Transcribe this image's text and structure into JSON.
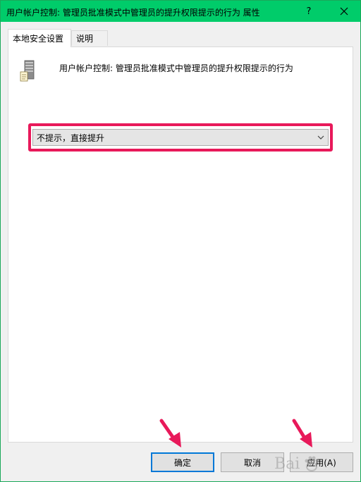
{
  "window": {
    "title": "用户帐户控制: 管理员批准模式中管理员的提升权限提示的行为 属性",
    "help_label": "?"
  },
  "tabs": [
    {
      "label": "本地安全设置",
      "active": true
    },
    {
      "label": "说明",
      "active": false
    }
  ],
  "policy": {
    "icon": "server-policy-icon",
    "title": "用户帐户控制: 管理员批准模式中管理员的提升权限提示的行为"
  },
  "setting": {
    "selected_value": "不提示，直接提升"
  },
  "buttons": {
    "ok_label": "确定",
    "cancel_label": "取消",
    "apply_label": "应用(A)"
  },
  "annotations": {
    "highlight_color": "#e8195a",
    "arrow_color": "#e8195a"
  },
  "watermark": {
    "text": "Bai"
  },
  "colors": {
    "titlebar": "#00cc6a",
    "focus_border": "#0078d7"
  }
}
